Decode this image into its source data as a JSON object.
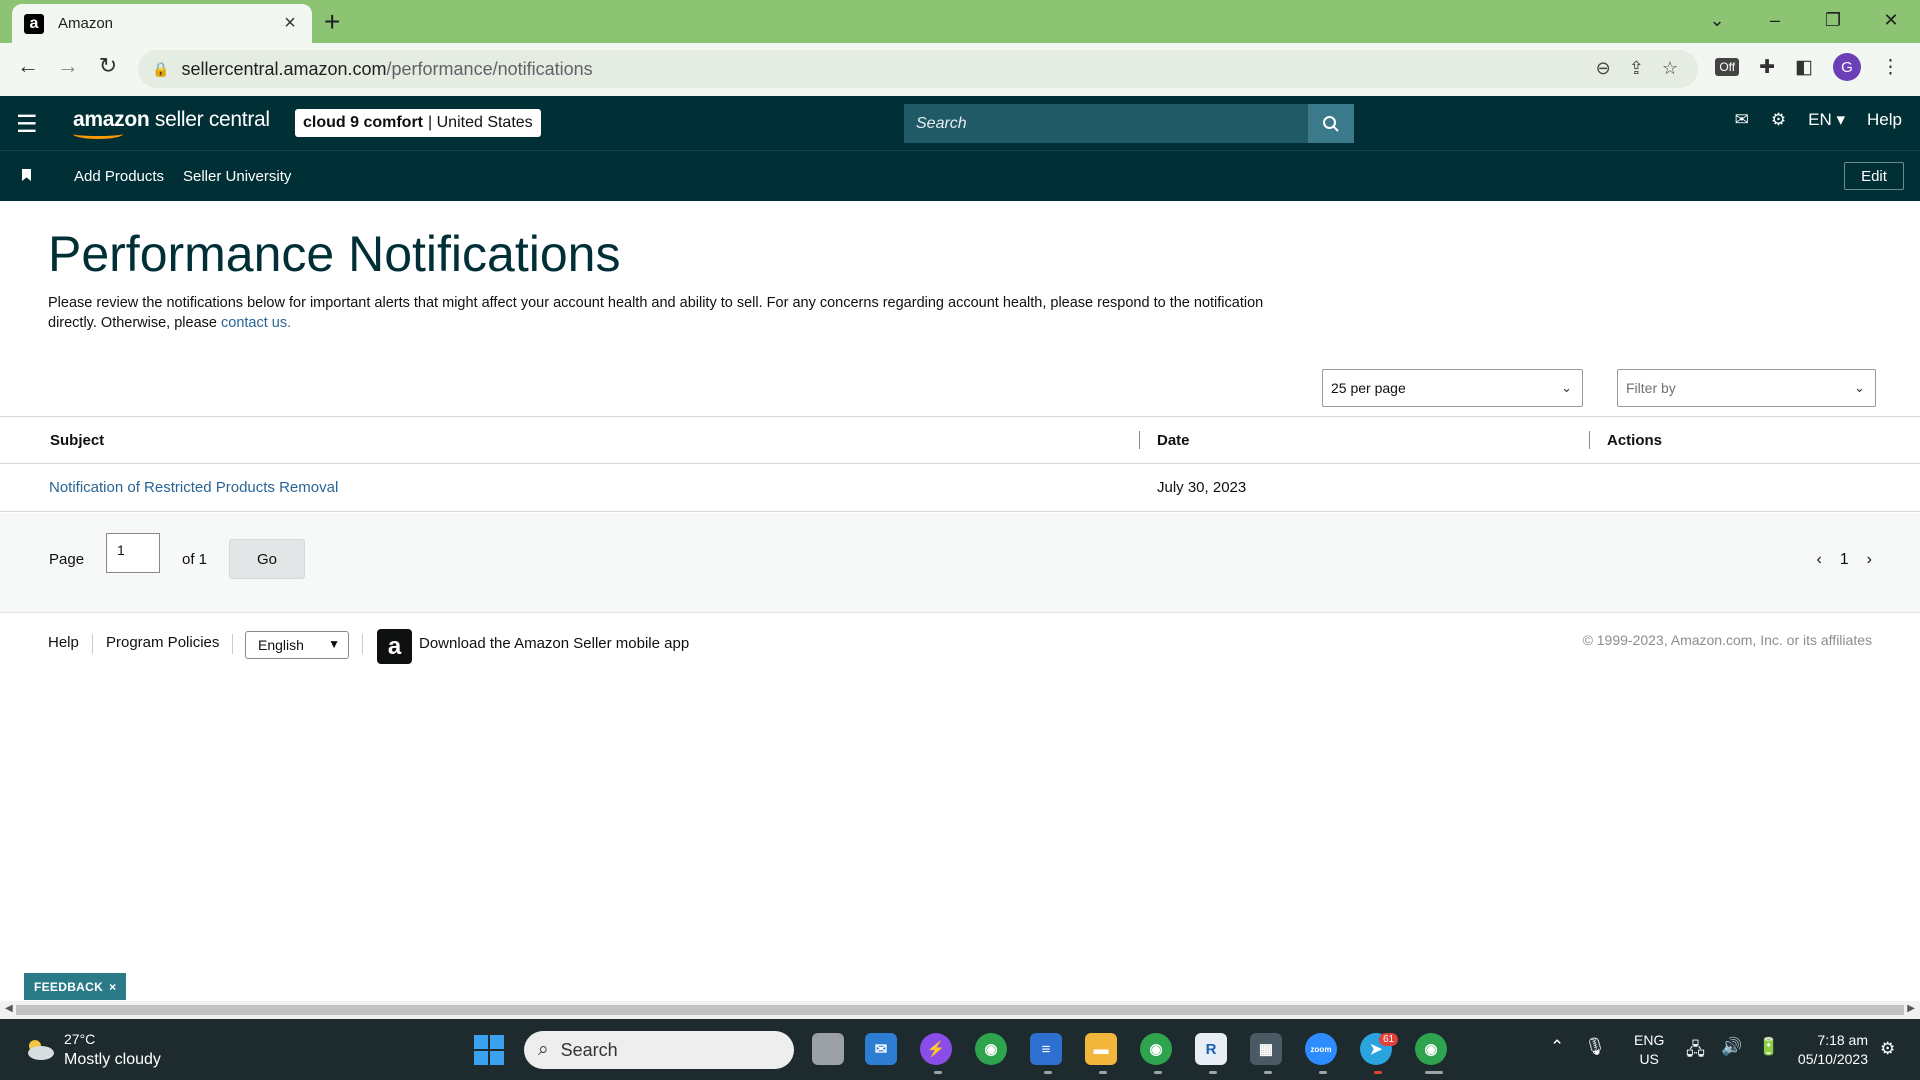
{
  "browser": {
    "tab_title": "Amazon",
    "tab_favicon": "a",
    "url_host": "sellercentral.amazon.com",
    "url_path": "/performance/notifications",
    "profile_initial": "G",
    "ext_off_label": "Off"
  },
  "header": {
    "logo_bold": "amazon",
    "logo_rest": " seller central",
    "store_name": "cloud 9 comfort",
    "store_region": "| United States",
    "search_placeholder": "Search",
    "language": "EN",
    "help": "Help"
  },
  "subnav": {
    "items": [
      "Add Products",
      "Seller University"
    ],
    "edit": "Edit"
  },
  "page": {
    "title": "Performance Notifications",
    "intro_text": "Please review the notifications below for important alerts that might affect your account health and ability to sell. For any concerns regarding account health, please respond to the notification directly. Otherwise, please ",
    "intro_link": "contact us."
  },
  "controls": {
    "per_page": "25 per page",
    "filter_placeholder": "Filter by"
  },
  "table": {
    "columns": [
      "Subject",
      "Date",
      "Actions"
    ],
    "rows": [
      {
        "subject": "Notification of Restricted Products Removal",
        "date": "July 30, 2023",
        "actions": ""
      }
    ]
  },
  "pager": {
    "page_label": "Page",
    "current_page": "1",
    "of_label": "of 1",
    "go": "Go",
    "nav_current": "1"
  },
  "footer": {
    "help": "Help",
    "program_policies": "Program Policies",
    "language": "English",
    "app_icon_letter": "a",
    "app_text": "Download the Amazon Seller mobile app",
    "copyright": "© 1999-2023, Amazon.com, Inc. or its affiliates"
  },
  "feedback": {
    "label": "FEEDBACK",
    "close": "×"
  },
  "taskbar": {
    "temperature": "27°C",
    "weather": "Mostly cloudy",
    "search": "Search",
    "telegram_badge": "61",
    "zoom_label": "zoom",
    "lang_top": "ENG",
    "lang_bottom": "US",
    "time": "7:18 am",
    "date": "05/10/2023"
  },
  "colors": {
    "header_bg": "#002f36",
    "tab_strip": "#8cc474",
    "link": "#2a6496",
    "search_btn": "#3b7a8a",
    "feedback_bg": "#2b7a88"
  }
}
